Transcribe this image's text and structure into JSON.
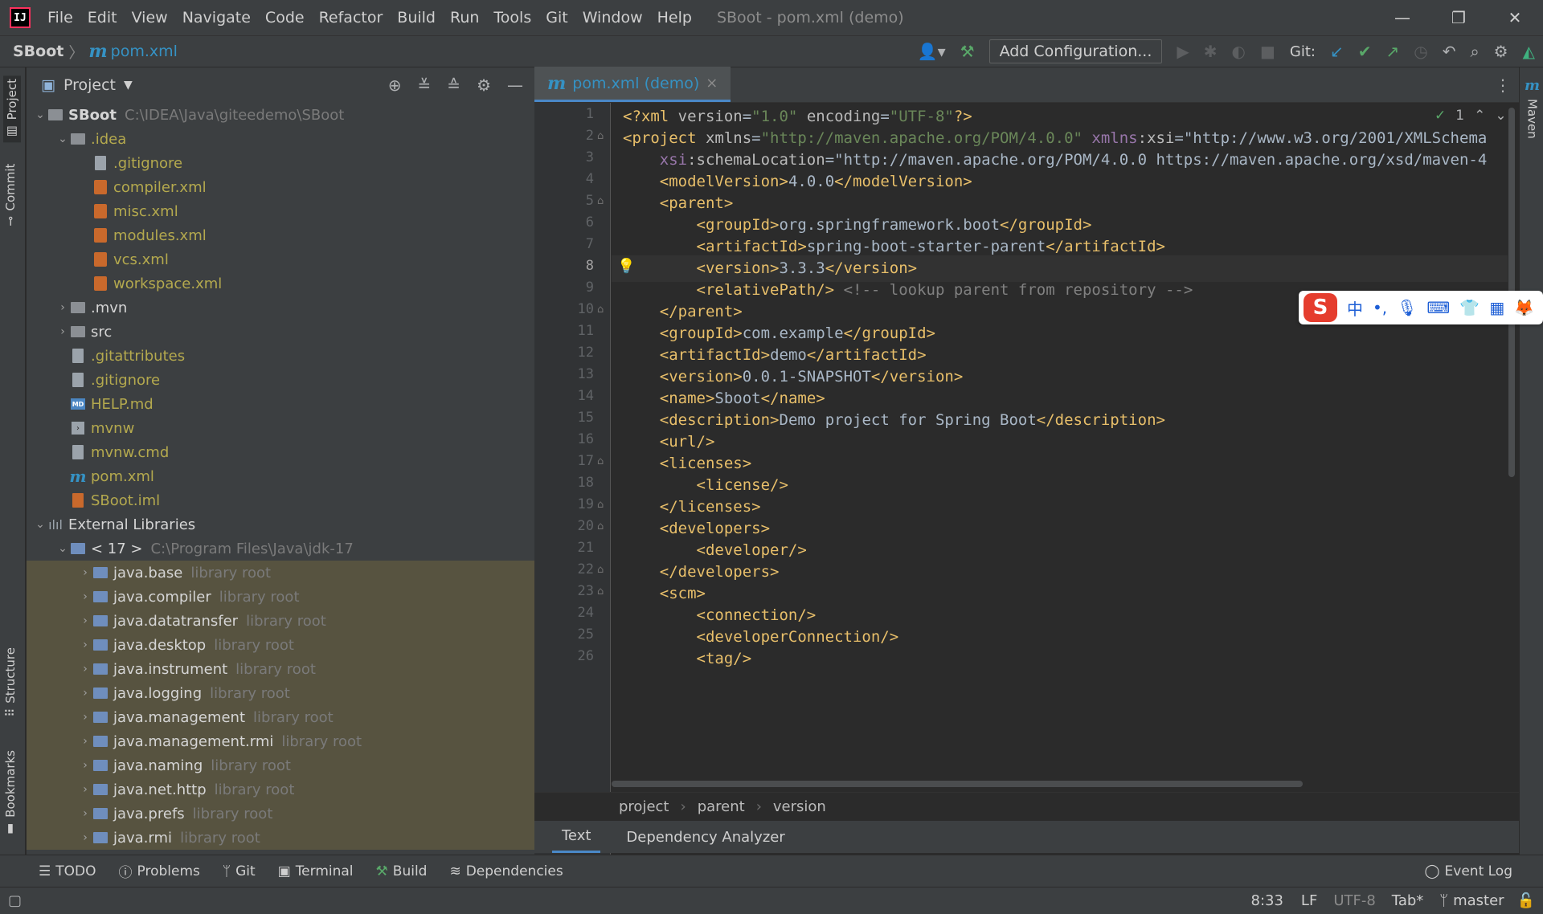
{
  "window": {
    "app_logo": "IJ",
    "title": "SBoot - pom.xml (demo)",
    "menu": [
      "File",
      "Edit",
      "View",
      "Navigate",
      "Code",
      "Refactor",
      "Build",
      "Run",
      "Tools",
      "Git",
      "Window",
      "Help"
    ],
    "controls": {
      "minimize": "—",
      "restore": "❐",
      "close": "✕"
    }
  },
  "navbar": {
    "project": "SBoot",
    "separator": "〉",
    "file_icon": "m",
    "file": "pom.xml",
    "add_configuration": "Add Configuration...",
    "git_label": "Git:"
  },
  "side_tabs": {
    "project": "Project",
    "commit": "Commit",
    "structure": "Structure",
    "bookmarks": "Bookmarks",
    "maven": "Maven"
  },
  "project_panel": {
    "title": "Project",
    "tree": [
      {
        "label": "SBoot",
        "path": "C:\\IDEA\\Java\\giteedemo\\SBoot",
        "icon": "module-folder-icon",
        "color": "white",
        "bold": true,
        "indent": 0,
        "chev": "⌄"
      },
      {
        "label": ".idea",
        "icon": "folder-icon",
        "color": "olive",
        "indent": 1,
        "chev": "⌄"
      },
      {
        "label": ".gitignore",
        "icon": "ignore-file-icon",
        "color": "olive",
        "indent": 2
      },
      {
        "label": "compiler.xml",
        "icon": "xml-file-icon",
        "color": "olive",
        "indent": 2
      },
      {
        "label": "misc.xml",
        "icon": "xml-file-icon",
        "color": "olive",
        "indent": 2
      },
      {
        "label": "modules.xml",
        "icon": "xml-file-icon",
        "color": "olive",
        "indent": 2
      },
      {
        "label": "vcs.xml",
        "icon": "xml-file-icon",
        "color": "olive",
        "indent": 2
      },
      {
        "label": "workspace.xml",
        "icon": "xml-file-icon",
        "color": "olive",
        "indent": 2
      },
      {
        "label": ".mvn",
        "icon": "folder-icon",
        "color": "white",
        "indent": 1,
        "chev": "›"
      },
      {
        "label": "src",
        "icon": "folder-icon",
        "color": "white",
        "indent": 1,
        "chev": "›"
      },
      {
        "label": ".gitattributes",
        "icon": "text-file-icon",
        "color": "olive",
        "indent": 1
      },
      {
        "label": ".gitignore",
        "icon": "ignore-file-icon",
        "color": "olive",
        "indent": 1
      },
      {
        "label": "HELP.md",
        "icon": "markdown-file-icon",
        "color": "olive",
        "indent": 1
      },
      {
        "label": "mvnw",
        "icon": "script-file-icon",
        "color": "olive",
        "indent": 1
      },
      {
        "label": "mvnw.cmd",
        "icon": "text-file-icon",
        "color": "olive",
        "indent": 1
      },
      {
        "label": "pom.xml",
        "icon": "maven-file-icon",
        "color": "olive",
        "indent": 1
      },
      {
        "label": "SBoot.iml",
        "icon": "iml-file-icon",
        "color": "olive",
        "indent": 1
      },
      {
        "label": "External Libraries",
        "icon": "libraries-icon",
        "color": "white",
        "indent": 0,
        "chev": "⌄"
      },
      {
        "label": "< 17 >",
        "path": "C:\\Program Files\\Java\\jdk-17",
        "icon": "jdk-folder-icon",
        "color": "white",
        "indent": 1,
        "chev": "⌄"
      },
      {
        "label": "java.base",
        "path": "library root",
        "icon": "library-folder-icon",
        "color": "white",
        "indent": 2,
        "chev": "›",
        "hl": true
      },
      {
        "label": "java.compiler",
        "path": "library root",
        "icon": "library-folder-icon",
        "color": "white",
        "indent": 2,
        "chev": "›",
        "hl": true
      },
      {
        "label": "java.datatransfer",
        "path": "library root",
        "icon": "library-folder-icon",
        "color": "white",
        "indent": 2,
        "chev": "›",
        "hl": true
      },
      {
        "label": "java.desktop",
        "path": "library root",
        "icon": "library-folder-icon",
        "color": "white",
        "indent": 2,
        "chev": "›",
        "hl": true
      },
      {
        "label": "java.instrument",
        "path": "library root",
        "icon": "library-folder-icon",
        "color": "white",
        "indent": 2,
        "chev": "›",
        "hl": true
      },
      {
        "label": "java.logging",
        "path": "library root",
        "icon": "library-folder-icon",
        "color": "white",
        "indent": 2,
        "chev": "›",
        "hl": true
      },
      {
        "label": "java.management",
        "path": "library root",
        "icon": "library-folder-icon",
        "color": "white",
        "indent": 2,
        "chev": "›",
        "hl": true
      },
      {
        "label": "java.management.rmi",
        "path": "library root",
        "icon": "library-folder-icon",
        "color": "white",
        "indent": 2,
        "chev": "›",
        "hl": true
      },
      {
        "label": "java.naming",
        "path": "library root",
        "icon": "library-folder-icon",
        "color": "white",
        "indent": 2,
        "chev": "›",
        "hl": true
      },
      {
        "label": "java.net.http",
        "path": "library root",
        "icon": "library-folder-icon",
        "color": "white",
        "indent": 2,
        "chev": "›",
        "hl": true
      },
      {
        "label": "java.prefs",
        "path": "library root",
        "icon": "library-folder-icon",
        "color": "white",
        "indent": 2,
        "chev": "›",
        "hl": true
      },
      {
        "label": "java.rmi",
        "path": "library root",
        "icon": "library-folder-icon",
        "color": "white",
        "indent": 2,
        "chev": "›",
        "hl": true
      }
    ]
  },
  "editor": {
    "tab_label": "pom.xml (demo)",
    "tab_close": "×",
    "inspection_count": "1",
    "current_line": 8,
    "lines": [
      "<?xml version=\"1.0\" encoding=\"UTF-8\"?>",
      "<project xmlns=\"http://maven.apache.org/POM/4.0.0\" xmlns:xsi=\"http://www.w3.org/2001/XMLSchema",
      "    xsi:schemaLocation=\"http://maven.apache.org/POM/4.0.0 https://maven.apache.org/xsd/maven-4",
      "    <modelVersion>4.0.0</modelVersion>",
      "    <parent>",
      "        <groupId>org.springframework.boot</groupId>",
      "        <artifactId>spring-boot-starter-parent</artifactId>",
      "        <version>3.3.3</version>",
      "        <relativePath/> <!-- lookup parent from repository -->",
      "    </parent>",
      "    <groupId>com.example</groupId>",
      "    <artifactId>demo</artifactId>",
      "    <version>0.0.1-SNAPSHOT</version>",
      "    <name>Sboot</name>",
      "    <description>Demo project for Spring Boot</description>",
      "    <url/>",
      "    <licenses>",
      "        <license/>",
      "    </licenses>",
      "    <developers>",
      "        <developer/>",
      "    </developers>",
      "    <scm>",
      "        <connection/>",
      "        <developerConnection/>",
      "        <tag/>"
    ],
    "breadcrumb": [
      "project",
      "parent",
      "version"
    ],
    "bottom_tabs": [
      "Text",
      "Dependency Analyzer"
    ]
  },
  "ime_toolbar": {
    "logo": "S",
    "lang": "中",
    "punct": "•,",
    "items": [
      "mic-icon",
      "keyboard-icon",
      "skin-icon",
      "apps-icon",
      "mascot-icon"
    ]
  },
  "tool_windows": [
    "TODO",
    "Problems",
    "Git",
    "Terminal",
    "Build",
    "Dependencies"
  ],
  "event_log": "Event Log",
  "status": {
    "position": "8:33",
    "line_sep": "LF",
    "encoding": "UTF-8",
    "indent": "Tab*",
    "branch": "master"
  },
  "colors": {
    "accent": "#4a88c7",
    "maven": "#3592c4",
    "highlight_row": "#575340",
    "success": "#59a869"
  }
}
